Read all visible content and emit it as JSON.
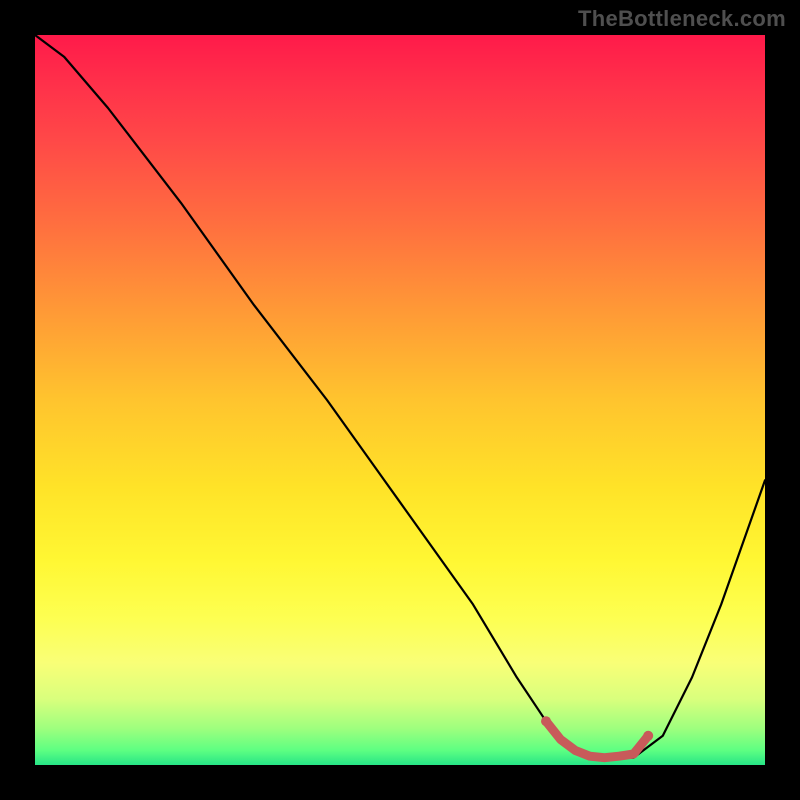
{
  "watermark": "TheBottleneck.com",
  "chart_data": {
    "type": "line",
    "title": "",
    "xlabel": "",
    "ylabel": "",
    "xlim": [
      0,
      100
    ],
    "ylim": [
      0,
      100
    ],
    "series": [
      {
        "name": "bottleneck-curve",
        "color": "#000000",
        "x": [
          0,
          4,
          10,
          20,
          30,
          40,
          50,
          60,
          66,
          70,
          74,
          78,
          82,
          86,
          90,
          94,
          100
        ],
        "values": [
          100,
          97,
          90,
          77,
          63,
          50,
          36,
          22,
          12,
          6,
          2,
          1,
          1,
          4,
          12,
          22,
          39
        ]
      },
      {
        "name": "optimal-segment",
        "color": "#c85a5a",
        "x": [
          70,
          72,
          74,
          76,
          78,
          80,
          82,
          84
        ],
        "values": [
          6,
          3.5,
          2,
          1.2,
          1,
          1.2,
          1.5,
          4
        ]
      }
    ],
    "gradient_stops": [
      {
        "pos": 0,
        "color": "#ff1a4a"
      },
      {
        "pos": 50,
        "color": "#ffc42e"
      },
      {
        "pos": 80,
        "color": "#fdff52"
      },
      {
        "pos": 100,
        "color": "#27e586"
      }
    ]
  }
}
